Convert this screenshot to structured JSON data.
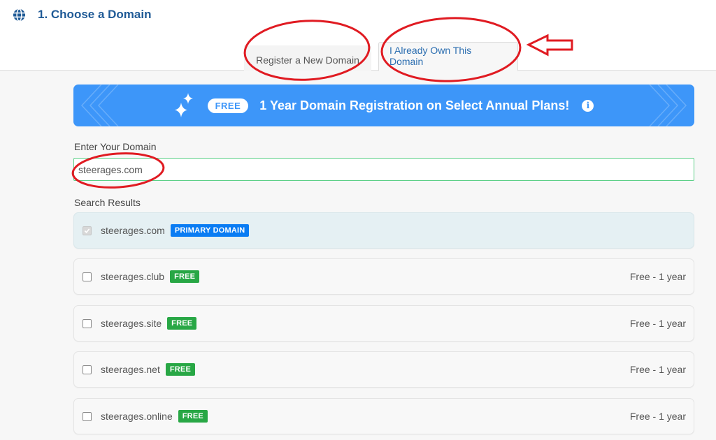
{
  "header": {
    "icon": "globe-icon",
    "title": "1. Choose a Domain"
  },
  "tabs": [
    {
      "label": "Register a New Domain",
      "active": false
    },
    {
      "label": "I Already Own This Domain",
      "active": true
    }
  ],
  "banner": {
    "icon": "sparkle-icon",
    "pill": "FREE",
    "text": "1 Year Domain Registration on Select Annual Plans!",
    "info_icon": "i"
  },
  "form": {
    "input_label": "Enter Your Domain",
    "input_value": "steerages.com",
    "results_label": "Search Results"
  },
  "results": [
    {
      "domain": "steerages.com",
      "badge": "PRIMARY DOMAIN",
      "badge_type": "primary",
      "checked": true,
      "disabled": true,
      "price": ""
    },
    {
      "domain": "steerages.club",
      "badge": "FREE",
      "badge_type": "free",
      "checked": false,
      "disabled": false,
      "price": "Free - 1 year"
    },
    {
      "domain": "steerages.site",
      "badge": "FREE",
      "badge_type": "free",
      "checked": false,
      "disabled": false,
      "price": "Free - 1 year"
    },
    {
      "domain": "steerages.net",
      "badge": "FREE",
      "badge_type": "free",
      "checked": false,
      "disabled": false,
      "price": "Free - 1 year"
    },
    {
      "domain": "steerages.online",
      "badge": "FREE",
      "badge_type": "free",
      "checked": false,
      "disabled": false,
      "price": "Free - 1 year"
    }
  ],
  "colors": {
    "title": "#1f5a96",
    "active_tab_text": "#2a6db0",
    "banner": "#3d96f9",
    "primary_badge": "#0a7cf3",
    "free_badge": "#28a745",
    "input_border": "#5ccf87",
    "annotation": "#e01b22"
  },
  "annotations": [
    {
      "type": "ellipse",
      "target": "tab-register-new-domain"
    },
    {
      "type": "ellipse",
      "target": "tab-already-own-domain"
    },
    {
      "type": "arrow",
      "direction": "left",
      "target": "tab-already-own-domain"
    },
    {
      "type": "ellipse",
      "target": "domain-input"
    }
  ]
}
